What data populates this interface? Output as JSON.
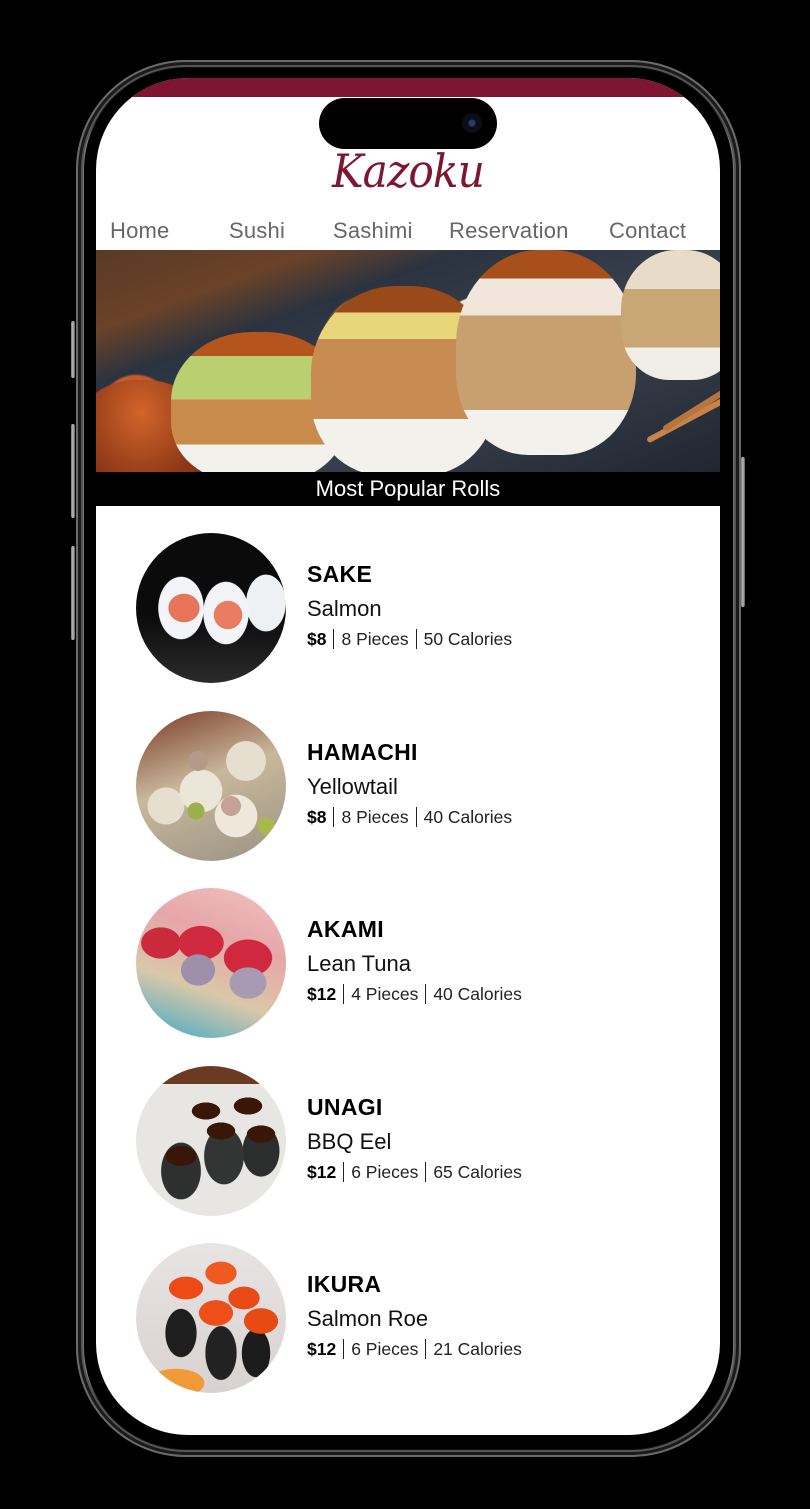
{
  "brand": {
    "logo_text": "Kazoku",
    "accent_color": "#7d1630"
  },
  "nav": {
    "items": [
      {
        "label": "Home"
      },
      {
        "label": "Sushi"
      },
      {
        "label": "Sashimi"
      },
      {
        "label": "Reservation"
      },
      {
        "label": "Contact"
      }
    ]
  },
  "hero": {
    "image_alt": "sushi-rolls-photo",
    "caption": "Most Popular Rolls"
  },
  "menu": {
    "items": [
      {
        "name": "SAKE",
        "subtitle": "Salmon",
        "price": "$8",
        "pieces": "8 Pieces",
        "calories": "50 Calories",
        "image": "salmon-roll-photo"
      },
      {
        "name": "HAMACHI",
        "subtitle": "Yellowtail",
        "price": "$8",
        "pieces": "8 Pieces",
        "calories": "40 Calories",
        "image": "yellowtail-roll-photo"
      },
      {
        "name": "AKAMI",
        "subtitle": "Lean Tuna",
        "price": "$12",
        "pieces": "4 Pieces",
        "calories": "40 Calories",
        "image": "tuna-roll-photo"
      },
      {
        "name": "UNAGI",
        "subtitle": "BBQ Eel",
        "price": "$12",
        "pieces": "6 Pieces",
        "calories": "65 Calories",
        "image": "eel-roll-photo"
      },
      {
        "name": "IKURA",
        "subtitle": "Salmon Roe",
        "price": "$12",
        "pieces": "6 Pieces",
        "calories": "21 Calories",
        "image": "salmon-roe-photo"
      }
    ]
  }
}
